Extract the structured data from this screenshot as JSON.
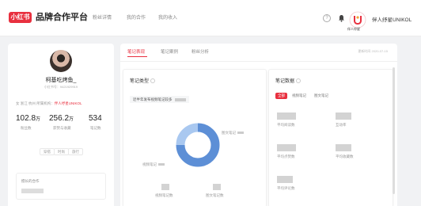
{
  "header": {
    "logo_badge": "小红书",
    "logo_text": "品牌合作平台",
    "nav": [
      "粉丝详情",
      "我的合作",
      "我的收入"
    ],
    "brand_sub": "伴人纾星",
    "user_name": "伴人纾星UNIKOL"
  },
  "profile": {
    "name": "柯基吃烤鱼_",
    "id_text": "小红书号：9421929919",
    "meta_prefix": "女 浙江 杭州   所属机构：",
    "meta_org": "伴人纾星UNIKOL",
    "stats": [
      {
        "value": "102.8",
        "unit": "万",
        "label": "粉丝数"
      },
      {
        "value": "256.2",
        "unit": "万",
        "label": "获赞与收藏"
      },
      {
        "value": "534",
        "unit": "",
        "label": "笔记数"
      }
    ],
    "tags": [
      "穿搭",
      "时尚",
      "旅行"
    ],
    "sub_card_title": "擅长的合作"
  },
  "main": {
    "tabs": [
      "笔记表现",
      "笔记案例",
      "粉丝分析"
    ],
    "update_time": "更新时间 2020-07-15",
    "note_type": {
      "title": "笔记类型",
      "desc": "近半年发布视频笔记较多",
      "label_right": "图文笔记",
      "label_left": "视频笔记",
      "captions": [
        "视频笔记数",
        "图文笔记数"
      ]
    },
    "note_data": {
      "title": "笔记数据",
      "tabs": [
        "全部",
        "视频笔记",
        "图文笔记"
      ],
      "captions": [
        "平均阅读数",
        "互动率",
        "平均点赞数",
        "平均收藏数",
        "平均评论数"
      ]
    },
    "chart_data": {
      "type": "pie",
      "labels": [
        "视频笔记",
        "图文笔记"
      ],
      "values": [
        75,
        25
      ],
      "colors": [
        "#5d8fd6",
        "#a9c8f0"
      ]
    }
  },
  "colors": {
    "accent": "#e8303f",
    "primary_series": "#5d8fd6",
    "secondary_series": "#a9c8f0"
  }
}
